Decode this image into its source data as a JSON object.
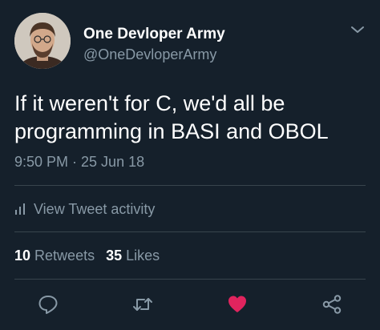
{
  "author": {
    "display_name": "One Devloper Army",
    "handle": "@OneDevloperArmy",
    "avatar_icon": "avatar-photo"
  },
  "tweet": {
    "text_line1": "If it weren't for C, we'd all be",
    "text_line2": "programming in BASI and OBOL",
    "timestamp": "9:50 PM · 25 Jun 18"
  },
  "activity": {
    "label": "View Tweet activity",
    "icon": "bar-chart-icon"
  },
  "stats": {
    "retweets_count": "10",
    "retweets_label": "Retweets",
    "likes_count": "35",
    "likes_label": "Likes"
  },
  "actions": {
    "reply_icon": "reply-icon",
    "retweet_icon": "retweet-icon",
    "like_icon": "heart-icon",
    "share_icon": "share-icon"
  },
  "colors": {
    "background": "#15202b",
    "text_primary": "#ffffff",
    "text_secondary": "#8899a6",
    "divider": "#38444d",
    "like": "#e0245e"
  }
}
